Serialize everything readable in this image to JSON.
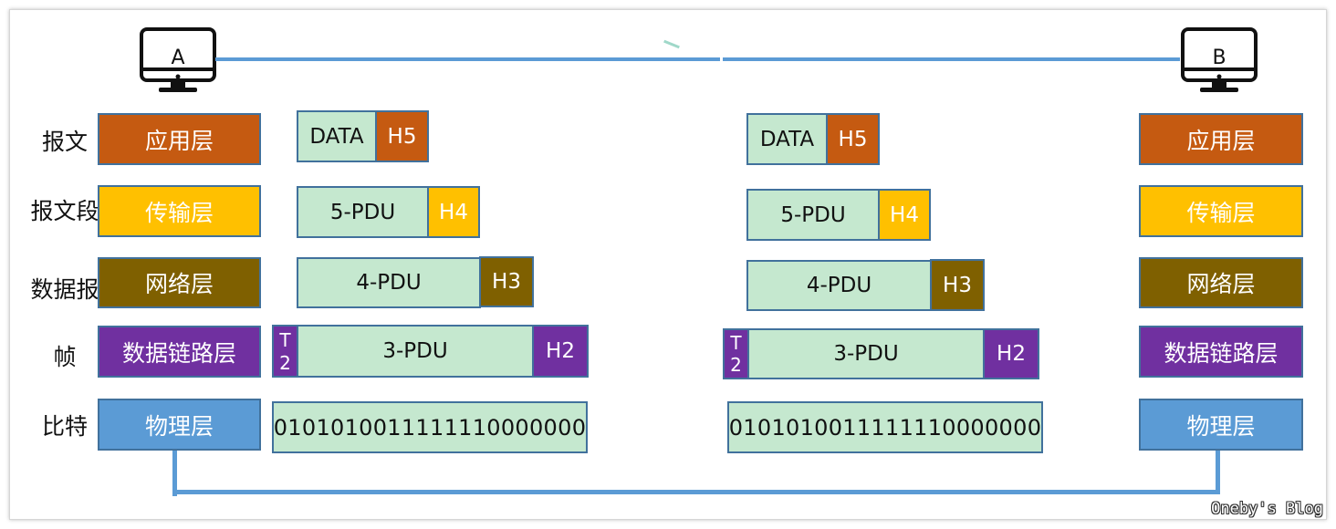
{
  "hosts": {
    "a": "A",
    "b": "B"
  },
  "colors": {
    "application": "#c55a11",
    "transport": "#ffc000",
    "network": "#7f6000",
    "datalink": "#7030a0",
    "physical": "#5b9bd5",
    "pdu_fill": "#c5e8cf",
    "line": "#5b9bd5"
  },
  "pdu_names": [
    "报文",
    "报文段",
    "数据报",
    "帧",
    "比特"
  ],
  "layers": [
    "应用层",
    "传输层",
    "网络层",
    "数据链路层",
    "物理层"
  ],
  "encapsulation": {
    "application": {
      "data": "DATA",
      "header": "H5"
    },
    "transport": {
      "data": "5-PDU",
      "header": "H4"
    },
    "network": {
      "data": "4-PDU",
      "header": "H3"
    },
    "datalink": {
      "trailer_top": "T",
      "trailer_bottom": "2",
      "data": "3-PDU",
      "header": "H2"
    },
    "physical": {
      "bits": "0101010011111110000000"
    }
  },
  "watermark": "Oneby's Blog"
}
